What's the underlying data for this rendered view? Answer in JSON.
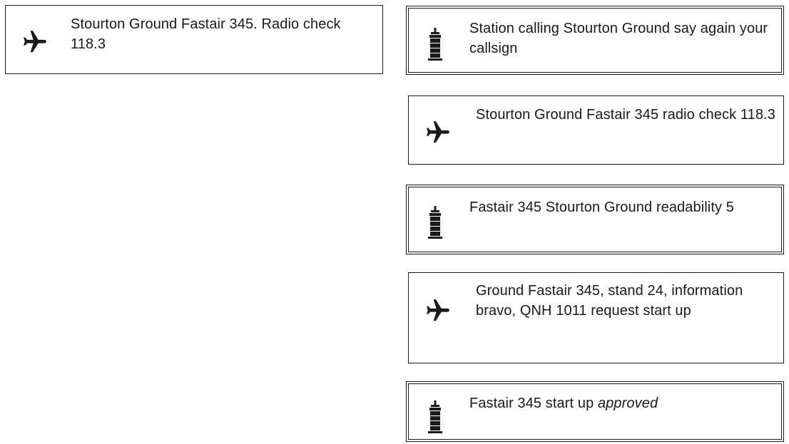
{
  "messages": [
    {
      "speaker": "pilot",
      "icon": "airplane-icon",
      "text": "Stourton Ground Fastair 345. Radio check 118.3"
    },
    {
      "speaker": "atc",
      "icon": "control-tower-icon",
      "text": "Station calling Stourton Ground say again your callsign"
    },
    {
      "speaker": "pilot",
      "icon": "airplane-icon",
      "text": "Stourton Ground Fastair 345 radio check 118.3"
    },
    {
      "speaker": "atc",
      "icon": "control-tower-icon",
      "text": "Fastair 345 Stourton Ground readability 5"
    },
    {
      "speaker": "pilot",
      "icon": "airplane-icon",
      "text": "Ground Fastair 345, stand 24, information bravo, QNH 1011 request start up"
    },
    {
      "speaker": "atc",
      "icon": "control-tower-icon",
      "text": "Fastair 345 start up",
      "text_emphasis": "approved"
    }
  ],
  "colors": {
    "ink": "#1a1a1a",
    "background": "#ffffff"
  }
}
